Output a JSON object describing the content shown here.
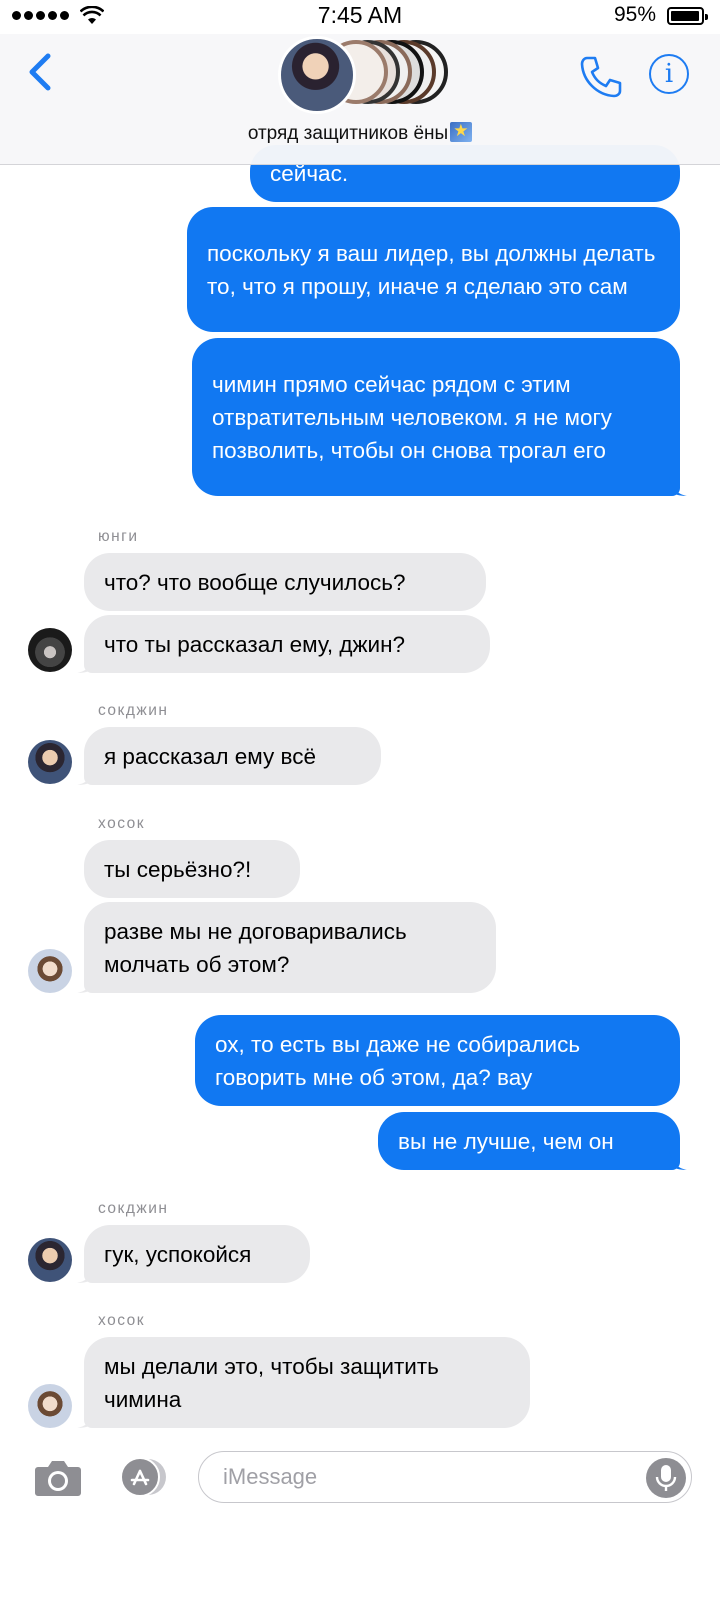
{
  "status_bar": {
    "time": "7:45 AM",
    "battery_percent": "95%",
    "battery_level": 0.95,
    "signal_bars": 5
  },
  "header": {
    "back_icon": "chevron-left-icon",
    "group_title": "отряд защитников ёны",
    "title_emoji": "shooting-star-emoji",
    "call_icon": "phone-icon",
    "info_icon": "info-icon",
    "info_glyph": "i"
  },
  "messages": [
    {
      "direction": "out",
      "text": "сейчас."
    },
    {
      "direction": "out",
      "text": "поскольку я ваш лидер, вы должны делать то, что я прошу, иначе я сделаю это сам"
    },
    {
      "direction": "out",
      "text": "чимин прямо сейчас рядом с этим отвратительным человеком. я не могу позволить, чтобы он снова трогал его"
    },
    {
      "sender": "юнги"
    },
    {
      "direction": "in",
      "text": "что? что вообще случилось?"
    },
    {
      "direction": "in",
      "text": "что ты рассказал ему, джин?"
    },
    {
      "sender": "сокджин"
    },
    {
      "direction": "in",
      "text": "я рассказал ему всё"
    },
    {
      "sender": "хосок"
    },
    {
      "direction": "in",
      "text": "ты серьёзно?!"
    },
    {
      "direction": "in",
      "text": "разве мы не договаривались молчать об этом?"
    },
    {
      "direction": "out",
      "text": "ох, то есть вы даже не собирались говорить мне об этом, да? вау"
    },
    {
      "direction": "out",
      "text": "вы не лучше, чем он"
    },
    {
      "sender": "сокджин"
    },
    {
      "direction": "in",
      "text": "гук, успокойся"
    },
    {
      "sender": "хосок"
    },
    {
      "direction": "in",
      "text": "мы делали это, чтобы защитить чимина"
    }
  ],
  "input_bar": {
    "camera_icon": "camera-icon",
    "apps_icon": "app-store-icon",
    "placeholder": "iMessage",
    "mic_icon": "microphone-icon"
  },
  "colors": {
    "outgoing_bubble": "#1178f2",
    "incoming_bubble": "#e9e9eb",
    "accent": "#1e7cf2"
  }
}
